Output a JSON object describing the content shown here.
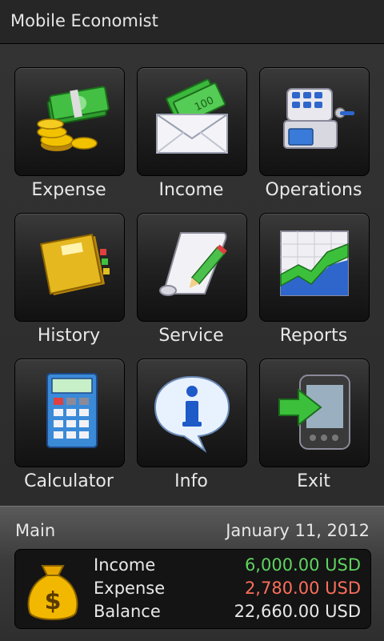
{
  "app": {
    "title": "Mobile Economist"
  },
  "tiles": [
    {
      "label": "Expense",
      "icon": "money-coins-icon"
    },
    {
      "label": "Income",
      "icon": "envelope-money-icon"
    },
    {
      "label": "Operations",
      "icon": "cash-register-icon"
    },
    {
      "label": "History",
      "icon": "book-icon"
    },
    {
      "label": "Service",
      "icon": "scroll-pencil-icon"
    },
    {
      "label": "Reports",
      "icon": "chart-icon"
    },
    {
      "label": "Calculator",
      "icon": "calculator-icon"
    },
    {
      "label": "Info",
      "icon": "info-bubble-icon"
    },
    {
      "label": "Exit",
      "icon": "exit-device-icon"
    }
  ],
  "footer": {
    "section": "Main",
    "date": "January 11, 2012",
    "income_label": "Income",
    "income_value": "6,000.00 USD",
    "expense_label": "Expense",
    "expense_value": "2,780.00 USD",
    "balance_label": "Balance",
    "balance_value": "22,660.00 USD",
    "colors": {
      "income": "#5fd35f",
      "expense": "#ff6e5a",
      "balance": "#e8e8e8"
    }
  }
}
